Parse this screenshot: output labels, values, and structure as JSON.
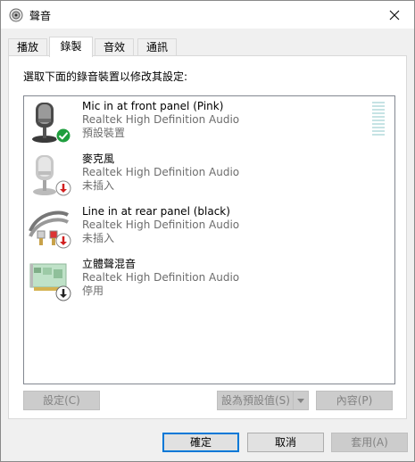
{
  "window": {
    "title": "聲音",
    "close_icon": "close-icon"
  },
  "tabs": [
    {
      "label": "播放",
      "active": false
    },
    {
      "label": "錄製",
      "active": true
    },
    {
      "label": "音效",
      "active": false
    },
    {
      "label": "通訊",
      "active": false
    }
  ],
  "panel": {
    "instruction": "選取下面的錄音裝置以修改其設定:",
    "devices": [
      {
        "name": "Mic in at front panel (Pink)",
        "driver": "Realtek High Definition Audio",
        "status": "預設裝置",
        "icon": "microphone-icon",
        "badge": "check-badge-icon",
        "selected": true
      },
      {
        "name": "麥克風",
        "driver": "Realtek High Definition Audio",
        "status": "未插入",
        "icon": "microphone-icon",
        "badge": "unplugged-badge-icon",
        "selected": false
      },
      {
        "name": "Line in at rear panel (black)",
        "driver": "Realtek High Definition Audio",
        "status": "未插入",
        "icon": "audio-cable-icon",
        "badge": "unplugged-badge-icon",
        "selected": false
      },
      {
        "name": "立體聲混音",
        "driver": "Realtek High Definition Audio",
        "status": "停用",
        "icon": "sound-card-icon",
        "badge": "disabled-badge-icon",
        "selected": false
      }
    ],
    "buttons": {
      "configure": "設定(C)",
      "set_default": "設為預設值(S)",
      "properties": "內容(P)"
    }
  },
  "footer": {
    "ok": "確定",
    "cancel": "取消",
    "apply": "套用(A)"
  },
  "colors": {
    "accent": "#0078d7",
    "check_green": "#1f9e3e",
    "unplugged_red": "#d11f1f",
    "level_meter": "#c6e3e4"
  }
}
